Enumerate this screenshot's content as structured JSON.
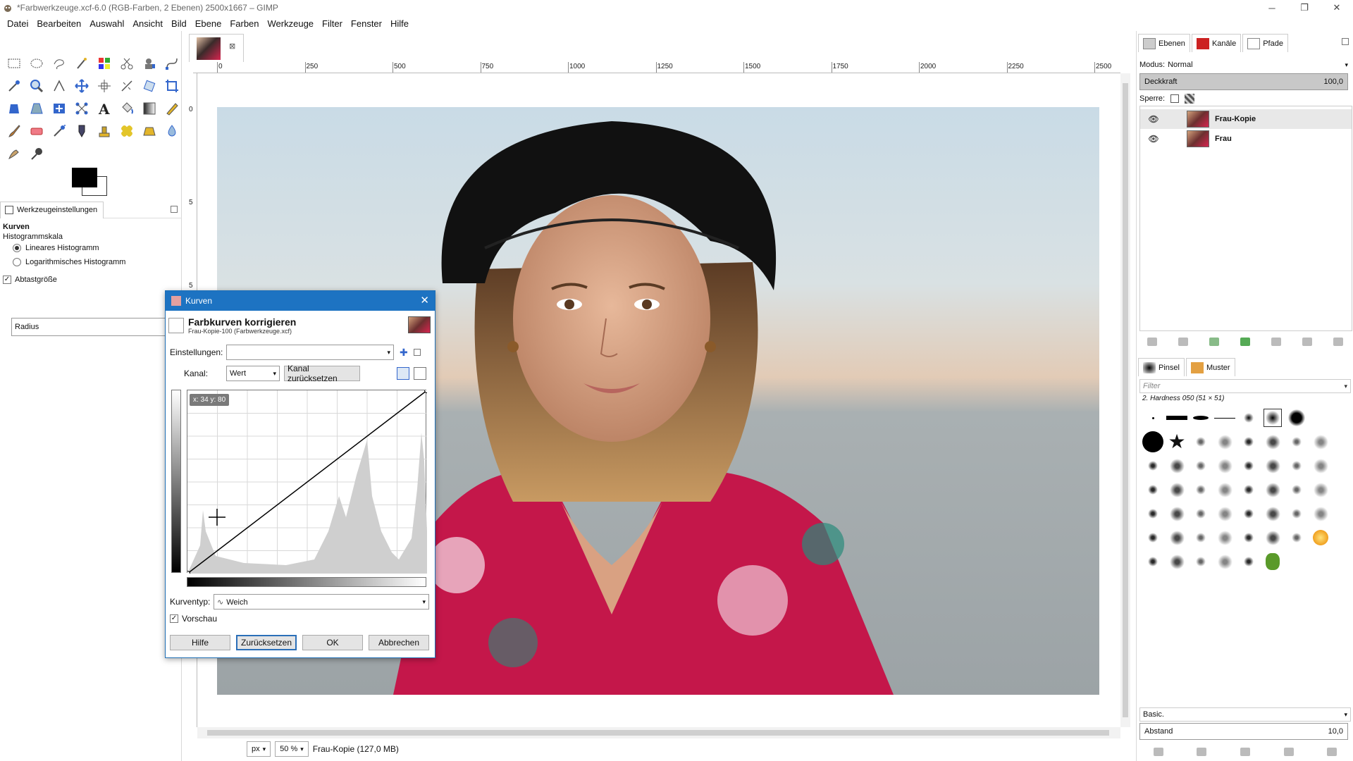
{
  "window": {
    "title": "*Farbwerkzeuge.xcf-6.0 (RGB-Farben, 2 Ebenen) 2500x1667 – GIMP",
    "minimize": "─",
    "maximize": "❐",
    "close": "✕"
  },
  "menu": [
    "Datei",
    "Bearbeiten",
    "Auswahl",
    "Ansicht",
    "Bild",
    "Ebene",
    "Farben",
    "Werkzeuge",
    "Filter",
    "Fenster",
    "Hilfe"
  ],
  "tool_options": {
    "tab_label": "Werkzeugeinstellungen",
    "tool_name": "Kurven",
    "histogram_scale": "Histogrammskala",
    "linear": "Lineares Histogramm",
    "log": "Logarithmisches Histogramm",
    "sample_size": "Abtastgröße",
    "radius": "Radius"
  },
  "rulers": {
    "h": [
      "0",
      "250",
      "500",
      "750",
      "1000",
      "1250",
      "1500",
      "1750",
      "2000",
      "2250",
      "2500"
    ],
    "v": [
      "0",
      "5",
      "5"
    ]
  },
  "status": {
    "unit": "px",
    "zoom": "50 %",
    "info": "Frau-Kopie (127,0 MB)"
  },
  "layers_panel": {
    "tabs": [
      "Ebenen",
      "Kanäle",
      "Pfade"
    ],
    "mode_label": "Modus:",
    "mode_value": "Normal",
    "opacity_label": "Deckkraft",
    "opacity_value": "100,0",
    "lock_label": "Sperre:",
    "layers": [
      {
        "name": "Frau-Kopie",
        "selected": true
      },
      {
        "name": "Frau",
        "selected": false
      }
    ]
  },
  "brushes_panel": {
    "tabs": [
      "Pinsel",
      "Muster"
    ],
    "filter_placeholder": "Filter",
    "current_brush": "2. Hardness 050 (51 × 51)",
    "preset": "Basic.",
    "spacing_label": "Abstand",
    "spacing_value": "10,0"
  },
  "dialog": {
    "title": "Kurven",
    "heading": "Farbkurven korrigieren",
    "subheading": "Frau-Kopie-100 (Farbwerkzeuge.xcf)",
    "presets_label": "Einstellungen:",
    "channel_label": "Kanal:",
    "channel_value": "Wert",
    "reset_channel": "Kanal zurücksetzen",
    "tooltip": "x: 34 y: 80",
    "curve_type_label": "Kurventyp:",
    "curve_type_value": "Weich",
    "preview_label": "Vorschau",
    "buttons": {
      "help": "Hilfe",
      "reset": "Zurücksetzen",
      "ok": "OK",
      "cancel": "Abbrechen"
    }
  },
  "colors": {
    "accent": "#1d73c2",
    "fg": "#000000",
    "bg": "#ffffff"
  }
}
